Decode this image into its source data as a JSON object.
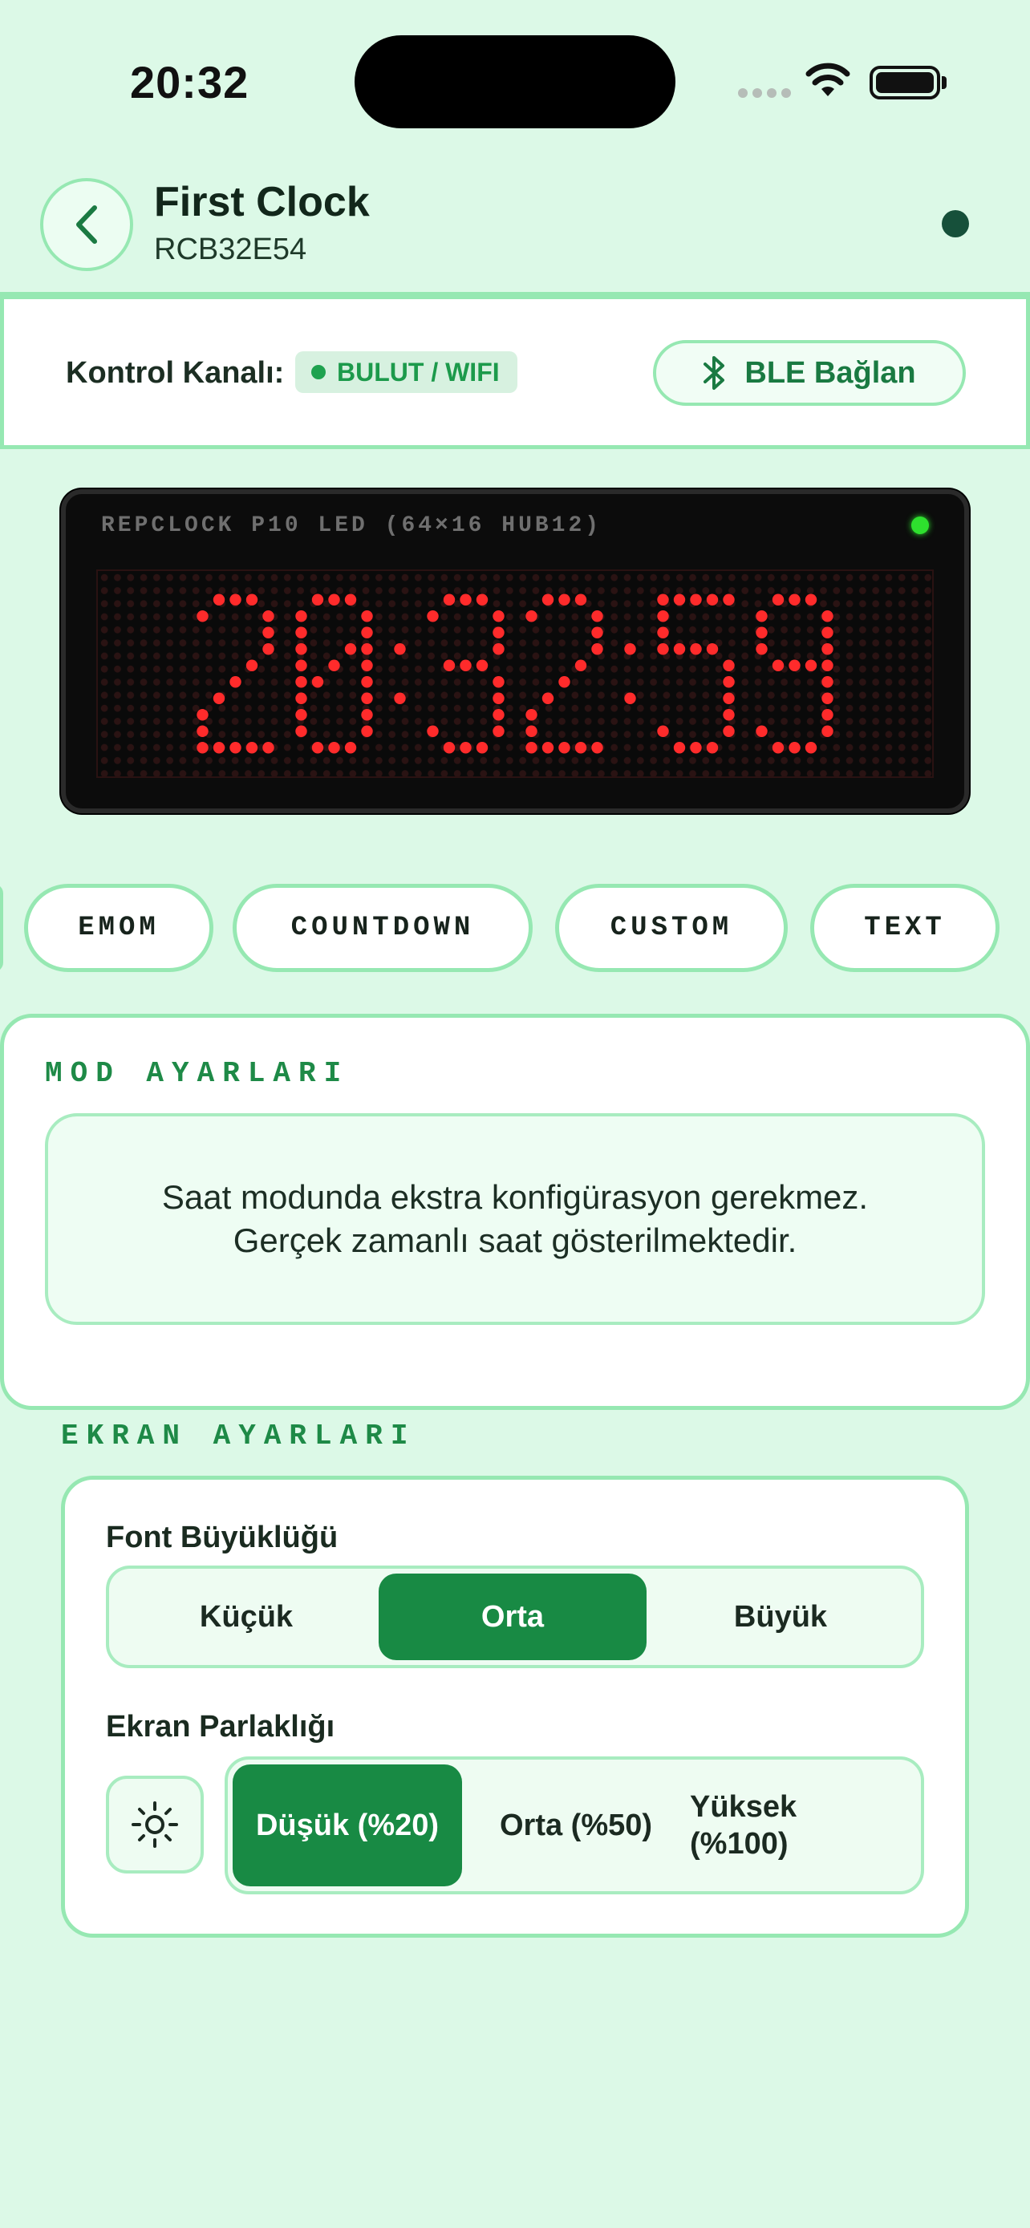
{
  "status_bar": {
    "time": "20:32"
  },
  "header": {
    "title": "First Clock",
    "subtitle": "RCB32E54"
  },
  "channel": {
    "label": "Kontrol Kanalı:",
    "badge": "BULUT / WIFI",
    "ble_button": "BLE Bağlan"
  },
  "display": {
    "model": "REPCLOCK P10 LED (64×16 HUB12)",
    "time": "20:32:59",
    "led_color": "#ff2b2b"
  },
  "modes": {
    "items": [
      "EMOM",
      "COUNTDOWN",
      "CUSTOM",
      "TEXT"
    ]
  },
  "mode_settings": {
    "title": "MOD AYARLARI",
    "info_line1": "Saat modunda ekstra konfigürasyon gerekmez.",
    "info_line2": "Gerçek zamanlı saat gösterilmektedir."
  },
  "screen_settings": {
    "title": "EKRAN AYARLARI",
    "font_label": "Font Büyüklüğü",
    "font_options": [
      "Küçük",
      "Orta",
      "Büyük"
    ],
    "font_selected": "Orta",
    "brightness_label": "Ekran Parlaklığı",
    "brightness_options": [
      "Düşük (%20)",
      "Orta (%50)",
      "Yüksek (%100)"
    ],
    "brightness_selected": "Düşük (%20)"
  },
  "colors": {
    "accent": "#188a44",
    "border": "#96e8b2",
    "background": "#dcf9e7"
  }
}
